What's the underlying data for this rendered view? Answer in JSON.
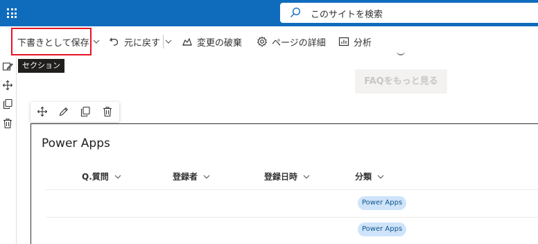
{
  "suite": {
    "search_placeholder": "このサイトを検索"
  },
  "commandbar": {
    "save_draft_label": "下書きとして保存",
    "undo_label": "元に戻す",
    "discard_label": "変更の破棄",
    "page_details_label": "ページの詳細",
    "analytics_label": "分析"
  },
  "tooltip": {
    "text": "セクション"
  },
  "faded": {
    "faq_button_label": "FAQをもっと見る"
  },
  "webpart": {
    "title": "Power Apps",
    "columns": [
      {
        "label": "Q.質問"
      },
      {
        "label": "登録者"
      },
      {
        "label": "登録日時"
      },
      {
        "label": "分類"
      }
    ],
    "rows": [
      {
        "category": "Power Apps"
      },
      {
        "category": "Power Apps"
      }
    ]
  },
  "colors": {
    "suite_blue": "#0f6cbd",
    "highlight_red": "#e81123",
    "tag_bg": "#cfe4fa",
    "tag_text": "#0f548c"
  }
}
